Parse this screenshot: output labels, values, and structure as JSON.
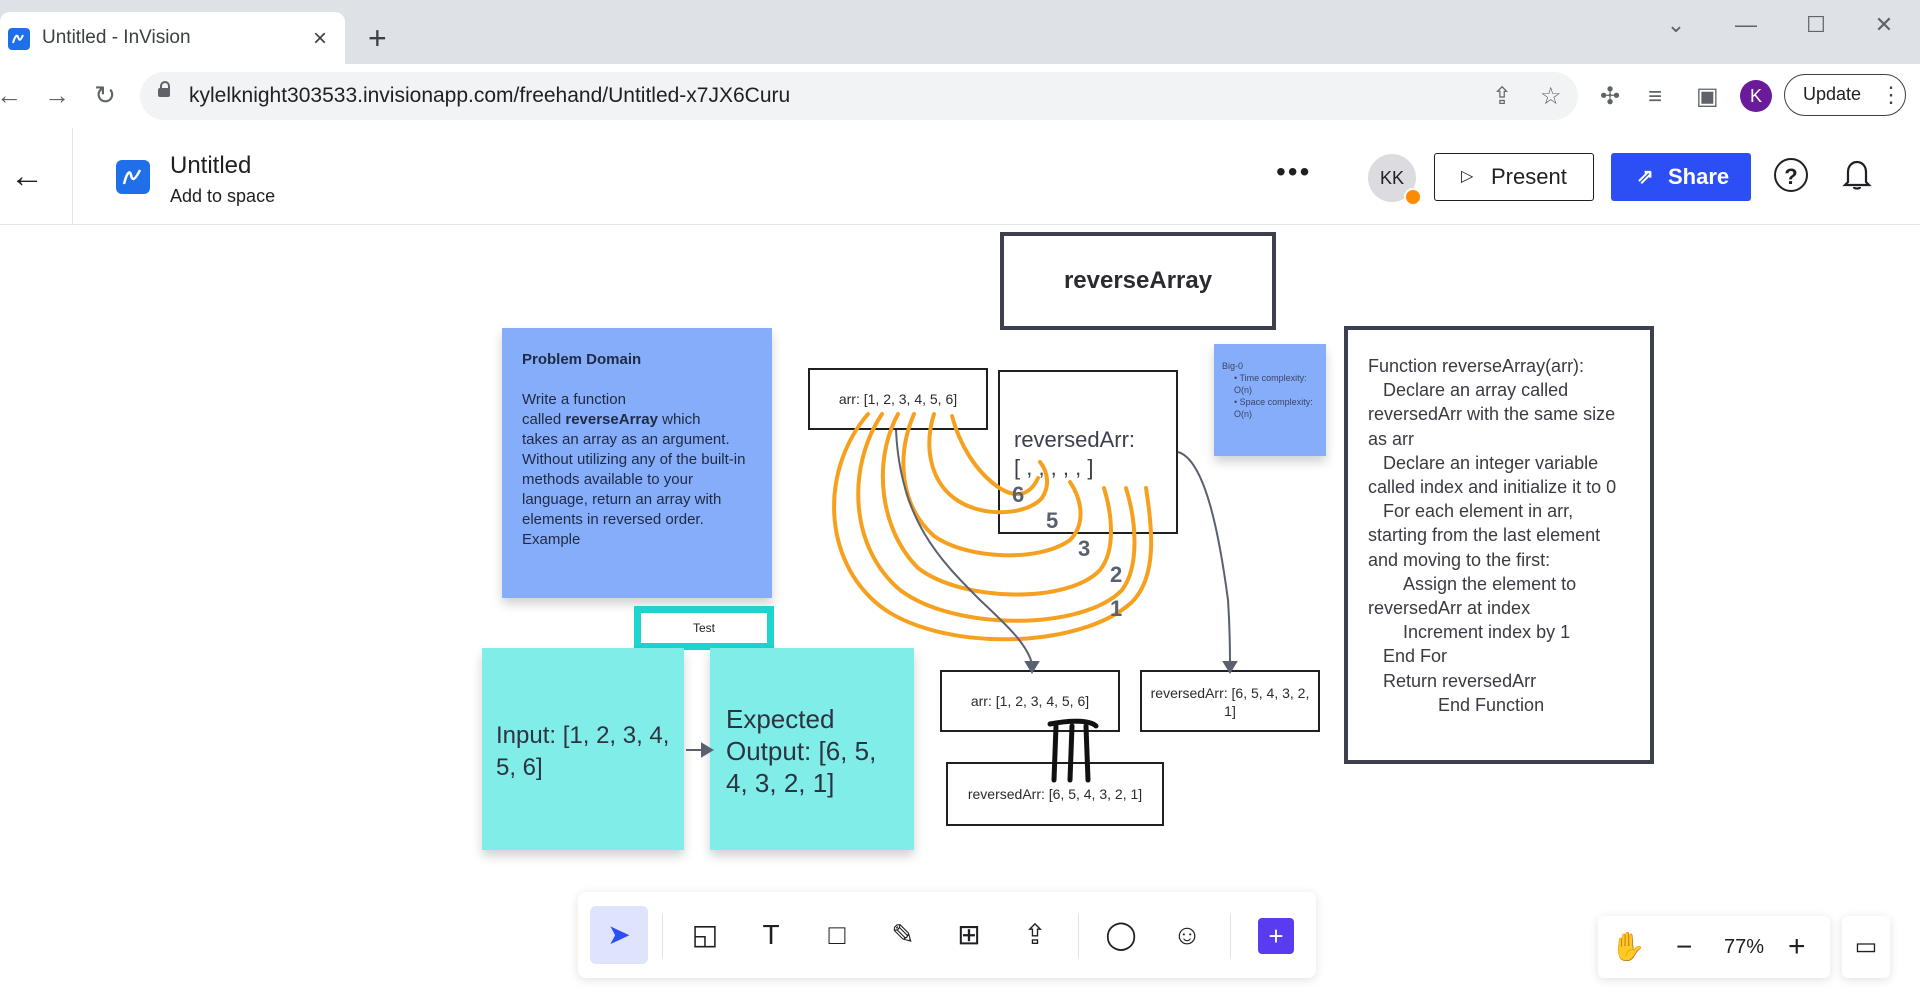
{
  "browser": {
    "tab_title": "Untitled - InVision",
    "tab_close": "×",
    "new_tab": "+",
    "url": "kylelknight303533.invisionapp.com/freehand/Untitled-x7JX6Curu",
    "profile_initial": "K",
    "update_label": "Update",
    "icons": [
      "back-icon",
      "forward-icon",
      "reload-icon",
      "lock-icon",
      "share-page-icon",
      "star-icon",
      "extensions-icon",
      "reading-list-icon",
      "side-panel-icon",
      "menu-icon"
    ]
  },
  "header": {
    "title": "Untitled",
    "subtitle": "Add to space",
    "more": "•••",
    "avatar_initials": "KK",
    "present_label": "Present",
    "share_label": "Share",
    "help": "?",
    "colors": {
      "share": "#2b4ef5",
      "presence": "#ff8a00"
    }
  },
  "canvas": {
    "title_frame": "reverseArray",
    "problem": {
      "heading": "Problem Domain",
      "line1": "Write a function",
      "line2_pre": "called ",
      "line2_bold": "reverseArray",
      "line2_post": " which",
      "rest": "takes an array as an argument. Without utilizing any of the built-in methods available to your language, return an array with elements in reversed order. Example"
    },
    "arr_top": "arr: [1, 2, 3, 4, 5, 6]",
    "reversed_label_1": "reversedArr:",
    "reversed_label_2": "[ , , , , , ]",
    "bigo": {
      "title": "Big-0",
      "items": [
        "Time complexity: O(n)",
        "Space complexity: O(n)"
      ]
    },
    "arrow_numbers": [
      "6",
      "5",
      "3",
      "2",
      "1"
    ],
    "pseudocode": [
      "Function reverseArray(arr):",
      "   Declare an array called reversedArr with the same size as arr",
      "   Declare an integer variable called index and initialize it to 0",
      "   For each element in arr, starting from the last element and moving to the first:",
      "       Assign the element to reversedArr at index",
      "       Increment index by 1",
      "   End For",
      "   Return reversedArr",
      "              End Function"
    ],
    "test_label": "Test",
    "input_text": "Input: [1, 2, 3, 4, 5, 6]",
    "expected_text": "Expected Output: [6, 5, 4, 3, 2, 1]",
    "arr_bottom": "arr: [1, 2, 3, 4, 5, 6]",
    "rev_out_right": "reversedArr: [6, 5, 4, 3, 2, 1]",
    "rev_out_bottom": "reversedArr: [6, 5, 4, 3, 2, 1]",
    "colors": {
      "sticky_blue": "#86adfa",
      "sticky_cyan": "#80ede9",
      "arrow_orange": "#f5a11f",
      "test_border": "#1fd3cf"
    }
  },
  "toolbar": {
    "tools": [
      "select-tool",
      "sticky-note-tool",
      "text-tool",
      "shape-tool",
      "pen-tool",
      "table-tool",
      "upload-tool",
      "comment-tool",
      "sticker-tool",
      "add-tool"
    ],
    "zoom_level": "77%",
    "zoom_out": "−",
    "zoom_in": "+"
  }
}
